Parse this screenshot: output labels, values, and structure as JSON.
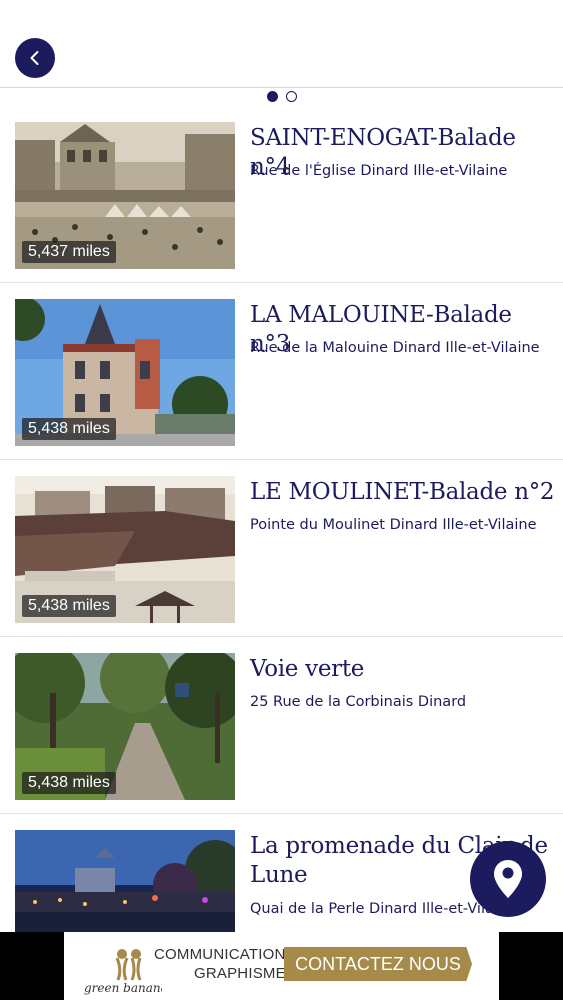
{
  "header": {
    "back_icon": "chevron-left-icon"
  },
  "carousel": {
    "pages": 2,
    "active_index": 0
  },
  "colors": {
    "primary": "#1b1b5e",
    "banner_gold": "#a68a4a"
  },
  "items": [
    {
      "title": "SAINT-ENOGAT-Balade n°4",
      "address": "Rue de l'Église Dinard Ille-et-Vilaine",
      "distance": "5,437 miles"
    },
    {
      "title": "LA MALOUINE-Balade n°3",
      "address": "Rue de la Malouine Dinard Ille-et-Vilaine",
      "distance": "5,438 miles"
    },
    {
      "title": "LE  MOULINET-Balade n°2",
      "address": "Pointe du Moulinet Dinard Ille-et-Vilaine",
      "distance": "5,438 miles"
    },
    {
      "title": "Voie verte",
      "address": "25 Rue de la Corbinais Dinard",
      "distance": "5,438 miles"
    },
    {
      "title": "La promenade du Clair de Lune",
      "address": "Quai de la Perle Dinard Ille-et-Vilaine",
      "distance": ""
    }
  ],
  "fab": {
    "icon": "map-pin-icon"
  },
  "banner": {
    "brand_line1": "COMMUNICATION",
    "brand_line2": "GRAPHISME",
    "brand_name": "green banana",
    "cta_label": "CONTACTEZ NOUS"
  }
}
